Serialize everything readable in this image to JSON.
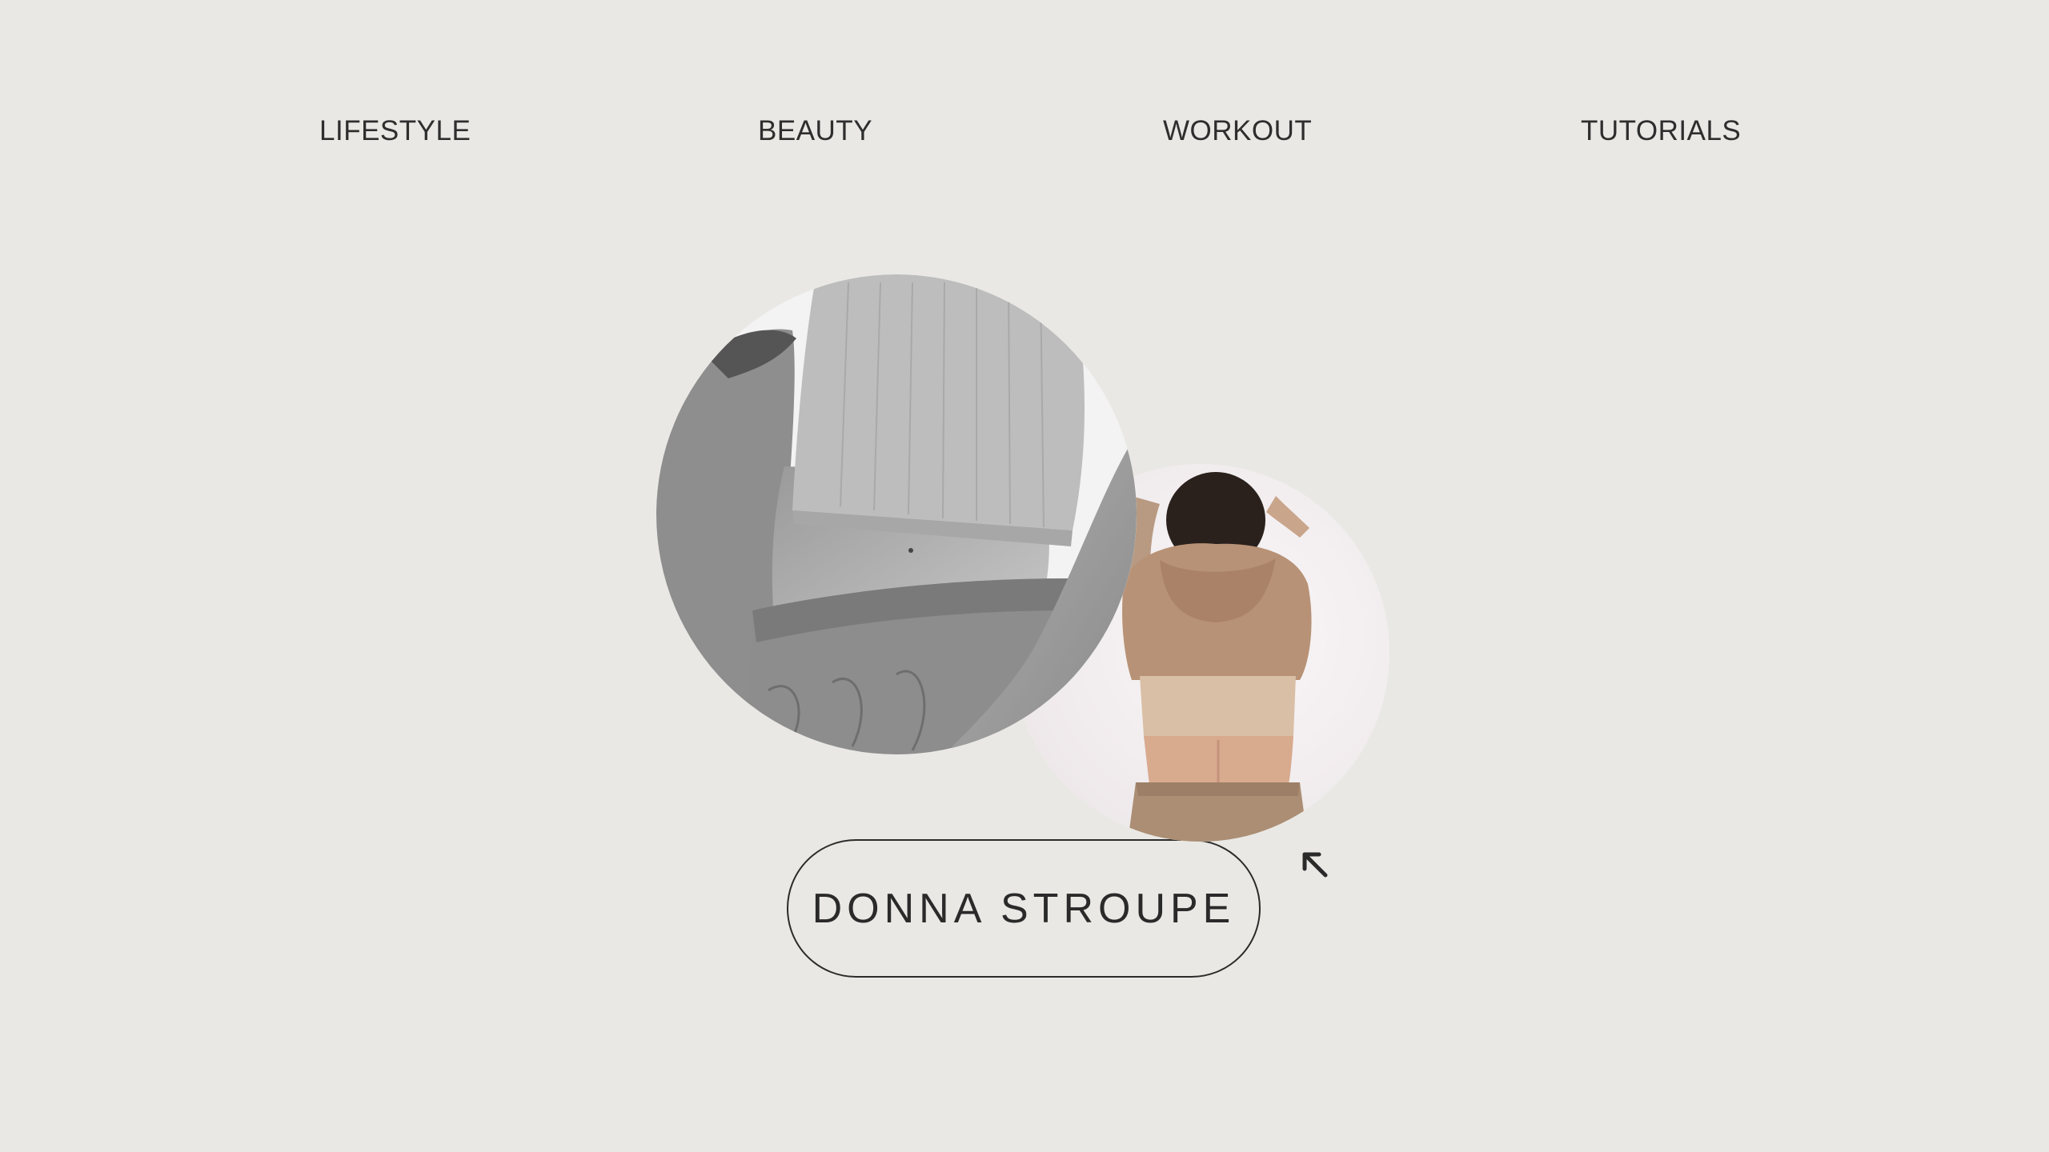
{
  "colors": {
    "background": "#e9e8e4",
    "text": "#2a2a2a",
    "border": "#2b2b2b"
  },
  "nav": {
    "items": [
      {
        "label": "LIFESTYLE"
      },
      {
        "label": "BEAUTY"
      },
      {
        "label": "WORKOUT"
      },
      {
        "label": "TUTORIALS"
      }
    ]
  },
  "hero": {
    "name": "DONNA STROUPE",
    "arrow_icon": "arrow-up-left-icon"
  }
}
